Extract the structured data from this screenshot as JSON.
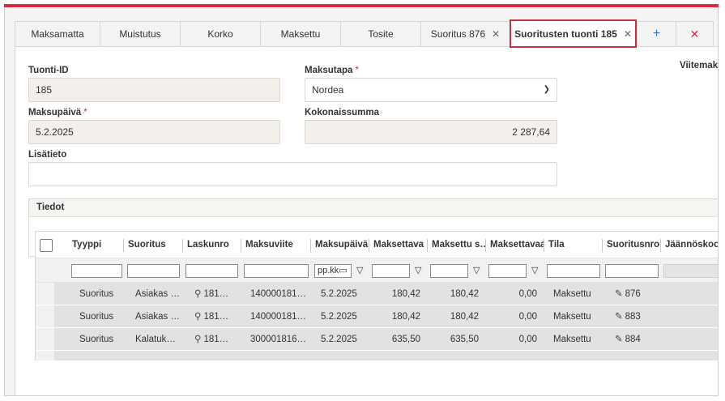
{
  "tabs": [
    {
      "label": "Maksamatta"
    },
    {
      "label": "Muistutus"
    },
    {
      "label": "Korko"
    },
    {
      "label": "Maksettu"
    },
    {
      "label": "Tosite"
    },
    {
      "label": "Suoritus 876",
      "close": "✕"
    },
    {
      "label": "Suoritusten tuonti 185",
      "close": "✕"
    }
  ],
  "tab_add": "+",
  "tab_close_all": "✕",
  "form": {
    "tuonti_id": {
      "label": "Tuonti-ID",
      "value": "185"
    },
    "maksutapa": {
      "label": "Maksutapa",
      "required": "*",
      "value": "Nordea"
    },
    "maksupaiva": {
      "label": "Maksupäivä",
      "required": "*",
      "value": "5.2.2025"
    },
    "kokonaissumma": {
      "label": "Kokonaissumma",
      "value": "2 287,64"
    },
    "lisatieto": {
      "label": "Lisätieto",
      "value": ""
    },
    "viitemaksu_label": "Viitemaks"
  },
  "section": {
    "title": "Tiedot"
  },
  "grid": {
    "columns": [
      "Tyyppi",
      "Suoritus",
      "Laskunro",
      "Maksuviite",
      "Maksupäivä",
      "Maksettava",
      "Maksettu s…",
      "Maksettavaa",
      "Tila",
      "Suoritusnro",
      "Jäännöskoo"
    ],
    "date_filter_placeholder": "pp.kk",
    "rows": [
      {
        "tyyppi": "Suoritus",
        "suoritus": "Asiakas …",
        "laskunro": "181…",
        "maksuviite": "140000181…",
        "maksupaiva": "5.2.2025",
        "maksettava": "180,42",
        "maksettu": "180,42",
        "maksettavaa": "0,00",
        "tila": "Maksettu",
        "suoritusnro": "876"
      },
      {
        "tyyppi": "Suoritus",
        "suoritus": "Asiakas …",
        "laskunro": "181…",
        "maksuviite": "140000181…",
        "maksupaiva": "5.2.2025",
        "maksettava": "180,42",
        "maksettu": "180,42",
        "maksettavaa": "0,00",
        "tila": "Maksettu",
        "suoritusnro": "883"
      },
      {
        "tyyppi": "Suoritus",
        "suoritus": "Kalatuk…",
        "laskunro": "181…",
        "maksuviite": "300001816…",
        "maksupaiva": "5.2.2025",
        "maksettava": "635,50",
        "maksettu": "635,50",
        "maksettavaa": "0,00",
        "tila": "Maksettu",
        "suoritusnro": "884"
      }
    ]
  },
  "icons": {
    "search": "search-icon",
    "pencil": "pencil-icon",
    "funnel": "filter-icon",
    "calendar": "calendar-icon"
  },
  "colors": {
    "accent": "#d42f3c",
    "field_bg": "#f3efea",
    "row_bg": "#e2e2e2"
  }
}
